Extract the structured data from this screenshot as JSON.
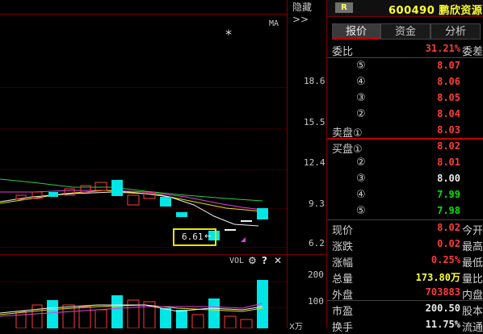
{
  "chart": {
    "hide_label": "隐藏>>",
    "ma_label": "MA",
    "y_ticks": [
      "18.6",
      "15.5",
      "12.4",
      "9.3",
      "6.2"
    ],
    "low_annotation": "6.61",
    "vol_label": "VOL",
    "vol_ticks": [
      "200",
      "100"
    ],
    "x_unit": "X万",
    "colors": {
      "up": "#ff3c3c",
      "down": "#00e6e6",
      "grid": "#7a0000",
      "highlight": "#e6e600"
    }
  },
  "panel": {
    "badge": "R",
    "code": "600490",
    "name": "鹏欣资源",
    "tabs": [
      {
        "label": "报价",
        "active": true
      },
      {
        "label": "资金",
        "active": false
      },
      {
        "label": "分析",
        "active": false
      }
    ],
    "weibi": {
      "label": "委比",
      "value": "31.21%",
      "suffix": "委差"
    },
    "sell": [
      {
        "level": "⑤",
        "price": "8.07"
      },
      {
        "level": "④",
        "price": "8.06"
      },
      {
        "level": "③",
        "price": "8.05"
      },
      {
        "level": "②",
        "price": "8.04"
      },
      {
        "label": "卖盘①",
        "price": "8.03"
      }
    ],
    "buy": [
      {
        "label": "买盘①",
        "price": "8.02"
      },
      {
        "level": "②",
        "price": "8.01"
      },
      {
        "level": "③",
        "price": "8.00"
      },
      {
        "level": "④",
        "price": "7.99"
      },
      {
        "level": "⑤",
        "price": "7.98"
      }
    ],
    "stats": [
      {
        "label": "现价",
        "value": "8.02",
        "right": "今开"
      },
      {
        "label": "涨跌",
        "value": "0.02",
        "right": "最高"
      },
      {
        "label": "涨幅",
        "value": "0.25%",
        "right": "最低"
      },
      {
        "label": "总量",
        "value": "173.80万",
        "right": "量比"
      },
      {
        "label": "外盘",
        "value": "703883",
        "right": "内盘"
      },
      {
        "label": "市盈",
        "value": "200.50",
        "right": "股本"
      },
      {
        "label": "换手",
        "value": "11.75%",
        "right": "流通"
      }
    ]
  }
}
